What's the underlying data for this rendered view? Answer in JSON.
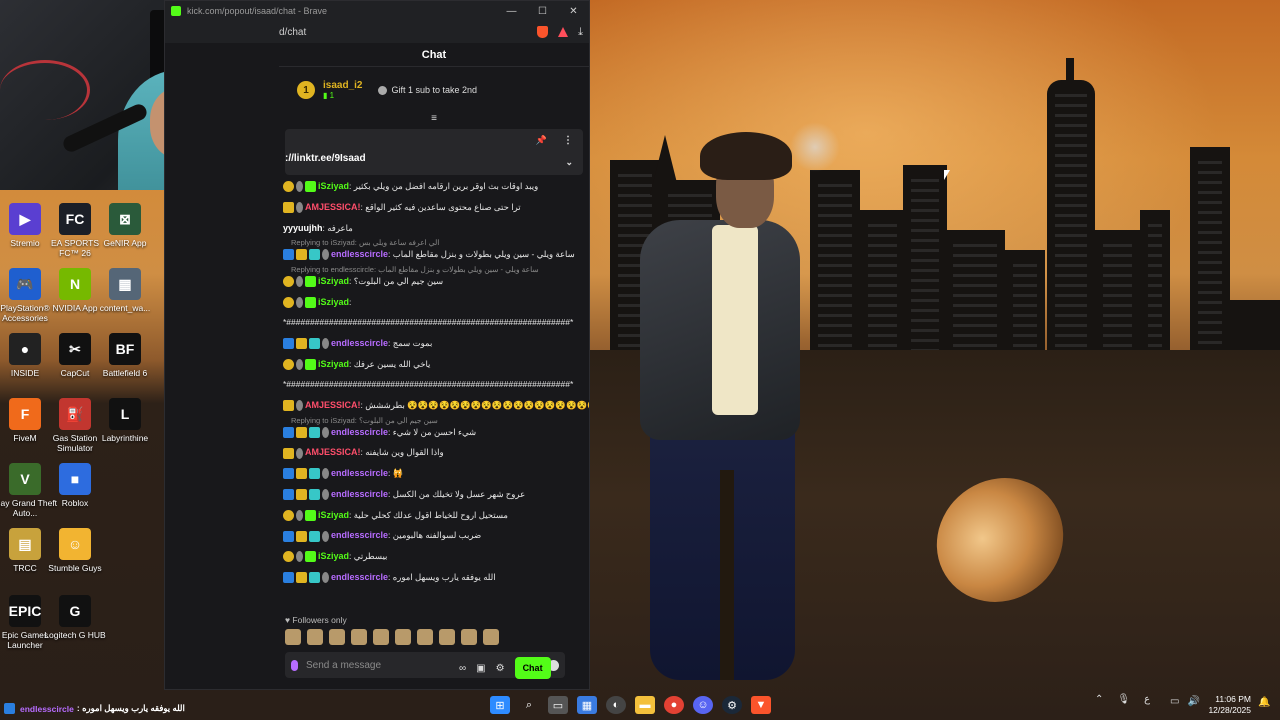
{
  "browser": {
    "title": "kick.com/popout/isaad/chat - Brave",
    "url_fragment": "d/chat",
    "window_controls": [
      "—",
      "☐",
      "✕"
    ]
  },
  "chat": {
    "header": "Chat",
    "leaderboard": {
      "rank": "1",
      "name": "isaad_i2",
      "sub_count": "1",
      "gift_text": "Gift 1 sub to take 2nd"
    },
    "pinned_text": "://linktr.ee/9Isaad",
    "messages": [
      {
        "user": "iSziyad",
        "color": "green",
        "badges": [
          "one",
          "gear",
          "vip"
        ],
        "text": "ويبد اوقات بث اوقر برين ارقامه افضل من ويلي بكثير"
      },
      {
        "user": "AMJESSICA!",
        "color": "pink",
        "badges": [
          "crown",
          "gear"
        ],
        "text": "ترا حتى صناع محتوى ساعدين فيه كثير الواقع"
      },
      {
        "user": "yyyuujhh",
        "color": "white",
        "badges": [],
        "text": "ماعرفه"
      },
      {
        "reply": "Replying to iSziyad: الي اعرفه ساعة ويلي بس",
        "user": "endlesscircle",
        "color": "purple",
        "badges": [
          "sub",
          "crown",
          "og",
          "gear"
        ],
        "text": "ساعة ويلي - سين ويلي بطولات و بنزل مقاطع الماب"
      },
      {
        "reply": "Replying to endlesscircle: ساعة ويلي - سين ويلي بطولات و بنزل مقاطع الماب",
        "user": "iSziyad",
        "color": "green",
        "badges": [
          "one",
          "gear",
          "vip"
        ],
        "text": "سين جيم الي من البلوت؟"
      },
      {
        "user": "iSziyad",
        "color": "green",
        "badges": [
          "one",
          "gear",
          "vip"
        ],
        "text": ""
      },
      {
        "user": "",
        "color": "white",
        "badges": [],
        "text": "*############################################################*"
      },
      {
        "user": "endlesscircle",
        "color": "purple",
        "badges": [
          "sub",
          "crown",
          "og",
          "gear"
        ],
        "text": "بموت سمج"
      },
      {
        "user": "iSziyad",
        "color": "green",
        "badges": [
          "one",
          "gear",
          "vip"
        ],
        "text": "ياخي الله يسين عرفك"
      },
      {
        "user": "",
        "color": "white",
        "badges": [],
        "text": "*############################################################*"
      },
      {
        "user": "AMJESSICA!",
        "color": "pink",
        "badges": [
          "crown",
          "gear"
        ],
        "text": "بطرششش 😵😵😵😵😵😵😵😵😵😵😵😵😵😵😵😵😵😵"
      },
      {
        "reply": "Replying to iSziyad: سين جيم الي من البلوت؟",
        "user": "endlesscircle",
        "color": "purple",
        "badges": [
          "sub",
          "crown",
          "og",
          "gear"
        ],
        "text": "شيء احسن من لا شيء"
      },
      {
        "user": "AMJESSICA!",
        "color": "pink",
        "badges": [
          "crown",
          "gear"
        ],
        "text": "واذا القوال وين شايفنه"
      },
      {
        "user": "endlesscircle",
        "color": "purple",
        "badges": [
          "sub",
          "crown",
          "og",
          "gear"
        ],
        "text": "🙀"
      },
      {
        "user": "endlesscircle",
        "color": "purple",
        "badges": [
          "sub",
          "crown",
          "og",
          "gear"
        ],
        "text": "عروح شهر عسل ولا تخيلك من الكسل"
      },
      {
        "user": "iSziyad",
        "color": "green",
        "badges": [
          "one",
          "gear",
          "vip"
        ],
        "text": "مستحيل اروح للخياط اقول عدلك كحلي حلية"
      },
      {
        "user": "endlesscircle",
        "color": "purple",
        "badges": [
          "sub",
          "crown",
          "og",
          "gear"
        ],
        "text": "ضربب لسوالفنه هالبومين"
      },
      {
        "user": "iSziyad",
        "color": "green",
        "badges": [
          "one",
          "gear",
          "vip"
        ],
        "text": "بيسطرتي"
      },
      {
        "user": "endlesscircle",
        "color": "purple",
        "badges": [
          "sub",
          "crown",
          "og",
          "gear"
        ],
        "text": "الله يوفقه يارب ويسهل اموره"
      }
    ],
    "followers_only": "Followers only",
    "input_placeholder": "Send a message",
    "send_button": "Chat"
  },
  "desktop_icons": [
    {
      "label": "Stremio",
      "color": "#5a3fd1",
      "glyph": "▶"
    },
    {
      "label": "EA SPORTS FC™ 26",
      "color": "#1b1f27",
      "glyph": "FC"
    },
    {
      "label": "GeNIR App",
      "color": "#2a5a3a",
      "glyph": "⊠"
    },
    {
      "label": "PlayStation® Accessories",
      "color": "#1f5fcf",
      "glyph": "🎮"
    },
    {
      "label": "NVIDIA App",
      "color": "#76b900",
      "glyph": "N"
    },
    {
      "label": "content_wa...",
      "color": "#567",
      "glyph": "▦"
    },
    {
      "label": "INSIDE",
      "color": "#222",
      "glyph": "●"
    },
    {
      "label": "CapCut",
      "color": "#111",
      "glyph": "✂"
    },
    {
      "label": "Battlefield 6",
      "color": "#111",
      "glyph": "BF"
    },
    {
      "label": "FiveM",
      "color": "#f06a1b",
      "glyph": "F"
    },
    {
      "label": "Gas Station Simulator",
      "color": "#c2362f",
      "glyph": "⛽"
    },
    {
      "label": "Labyrinthine",
      "color": "#111",
      "glyph": "L"
    },
    {
      "label": "Play Grand Theft Auto...",
      "color": "#3a6b2a",
      "glyph": "V"
    },
    {
      "label": "Roblox",
      "color": "#2d6cdf",
      "glyph": "■"
    },
    {
      "label": "TRCC",
      "color": "#c8a23c",
      "glyph": "▤"
    },
    {
      "label": "Stumble Guys",
      "color": "#f2b431",
      "glyph": "☺"
    },
    {
      "label": "Epic Games Launcher",
      "color": "#111",
      "glyph": "EPIC"
    },
    {
      "label": "Logitech G HUB",
      "color": "#111",
      "glyph": "G"
    }
  ],
  "bottom_message": {
    "user": "endlesscircle",
    "text": ": الله يوفقه يارب ويسهل اموره"
  },
  "clock": {
    "time": "11:06 PM",
    "date": "12/28/2025"
  },
  "tray_lang": "ع",
  "colors": {
    "kick_green": "#53fc18",
    "purple_user": "#b76cff",
    "pink_user": "#ff4e6b",
    "gold": "#e0b421"
  }
}
